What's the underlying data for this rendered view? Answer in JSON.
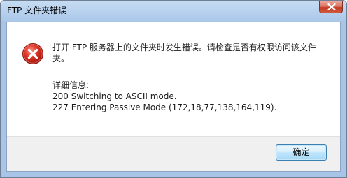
{
  "window": {
    "title": "FTP 文件夹错误"
  },
  "dialog": {
    "message": "打开 FTP 服务器上的文件夹时发生错误。请检查是否有权限访问该文件夹。",
    "details_header": "详细信息:",
    "details_lines": [
      "200 Switching to ASCII mode.",
      "227 Entering Passive Mode (172,18,77,138,164,119)."
    ]
  },
  "buttons": {
    "ok_label": "确定"
  },
  "icons": {
    "error": "error-icon",
    "close": "close-icon"
  },
  "colors": {
    "title_bar": "#b9d2ee",
    "close_button": "#c4381f",
    "error_red": "#d4261b",
    "footer": "#f0f0f0",
    "ok_border": "#3c7fb1"
  }
}
